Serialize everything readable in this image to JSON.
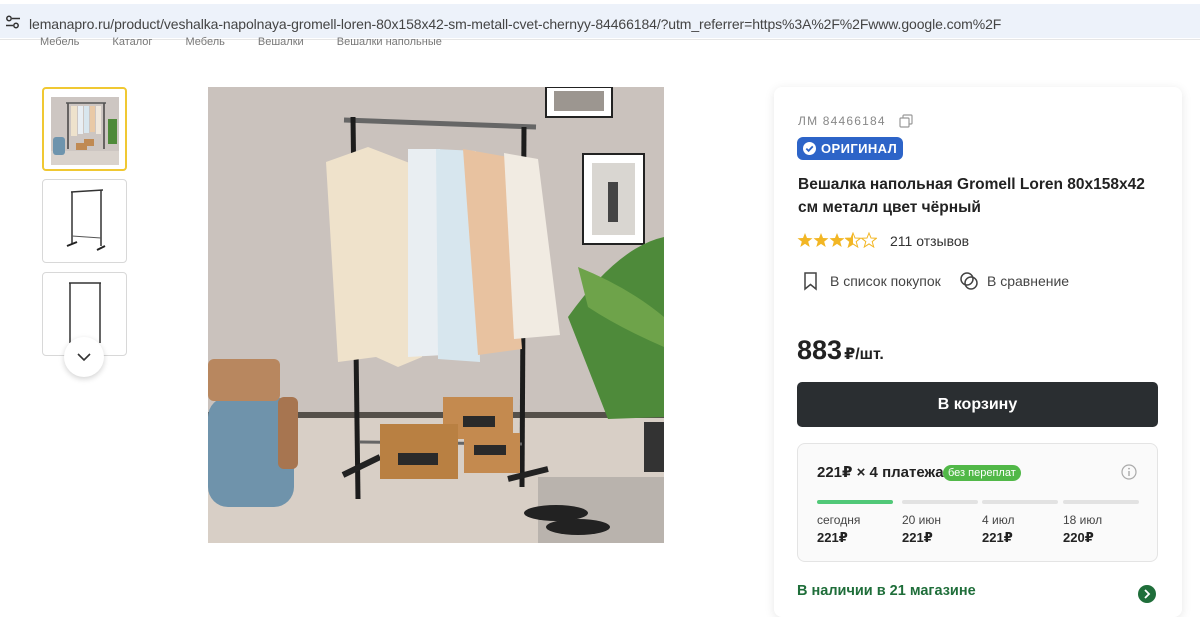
{
  "browser": {
    "url": "lemanapro.ru/product/veshalka-napolnaya-gromell-loren-80x158x42-sm-metall-cvet-chernyy-84466184/?utm_referrer=https%3A%2F%2Fwww.google.com%2F"
  },
  "breadcrumbs": [
    "Мебель",
    "Каталог",
    "Мебель",
    "Вешалки",
    "Вешалки напольные"
  ],
  "gallery": {
    "thumbnails": [
      "thumbnail-1",
      "thumbnail-2",
      "thumbnail-3"
    ],
    "more_icon": "chevron-down-icon"
  },
  "product": {
    "sku_label": "ЛМ 84466184",
    "badge": "ОРИГИНАЛ",
    "title": "Вешалка напольная Gromell Loren 80x158x42 см металл цвет чёрный",
    "rating": 3.5,
    "reviews": "211 отзывов",
    "shopping_list": "В список покупок",
    "compare": "В сравнение",
    "price": "883",
    "price_unit": "₽/шт.",
    "cart_button": "В корзину"
  },
  "installments": {
    "heading": "221₽ × 4 платежа",
    "tag": "без переплат",
    "steps": [
      {
        "date": "сегодня",
        "amount": "221₽",
        "active": true
      },
      {
        "date": "20 июн",
        "amount": "221₽",
        "active": false
      },
      {
        "date": "4 июл",
        "amount": "221₽",
        "active": false
      },
      {
        "date": "18 июл",
        "amount": "220₽",
        "active": false
      }
    ]
  },
  "availability": "В наличии в 21 магазине",
  "colors": {
    "accent_dark": "#2a2e31",
    "badge_blue": "#2d64c8",
    "green": "#51c878",
    "star": "#f2b624",
    "thumb_active": "#f0c832"
  }
}
